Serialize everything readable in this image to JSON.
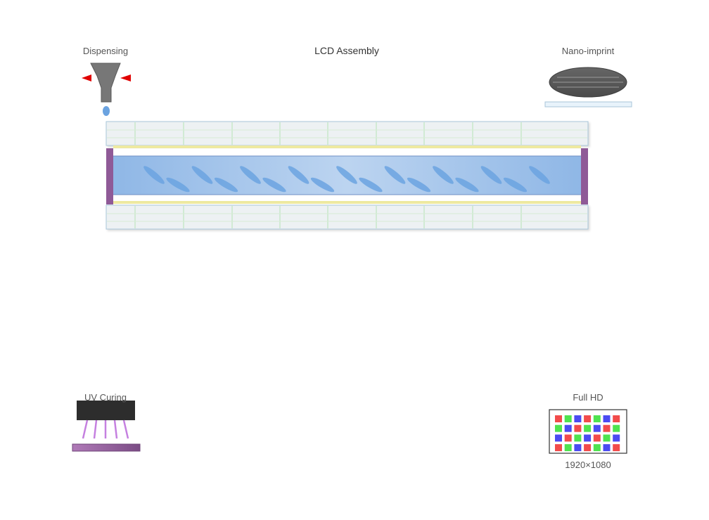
{
  "title": "LCD Assembly",
  "labels": {
    "dispensing": "Dispensing",
    "nano_imprint": "Nano-imprint",
    "uv_curing": "UV Curing",
    "full_hd": "Full HD",
    "resolution": "1920×1080"
  },
  "colors": {
    "glass_fill": "#edf1f3",
    "glass_stroke": "#a9c6da",
    "grid_line": "#b5e3b5",
    "alignment_layer": "#eee9a0",
    "lc_fill": "#a9c9ee",
    "lc_molecule": "#6ba3e0",
    "sealant": "#8f5a97",
    "nozzle": "#777777",
    "arrow": "#e00000",
    "droplet": "#6ba3e0",
    "stamp": "#555555",
    "uv_lamp": "#2d2d2d",
    "uv_rays": "#c580e0",
    "uv_substrate": "#9c6aa5",
    "pixel_red": "#f24b4b",
    "pixel_green": "#4fe34f",
    "pixel_blue": "#4b4bf2"
  },
  "icons": {
    "dispensing": "dispenser-nozzle-icon",
    "nano_imprint": "imprint-stamp-icon",
    "uv_curing": "uv-lamp-icon",
    "full_hd": "pixel-grid-icon"
  },
  "pixel_grid": [
    [
      "R",
      "G",
      "B",
      "R",
      "G",
      "B",
      "R"
    ],
    [
      "G",
      "B",
      "R",
      "G",
      "B",
      "R",
      "G"
    ],
    [
      "B",
      "R",
      "G",
      "B",
      "R",
      "G",
      "B"
    ],
    [
      "R",
      "G",
      "B",
      "R",
      "G",
      "B",
      "R"
    ]
  ]
}
